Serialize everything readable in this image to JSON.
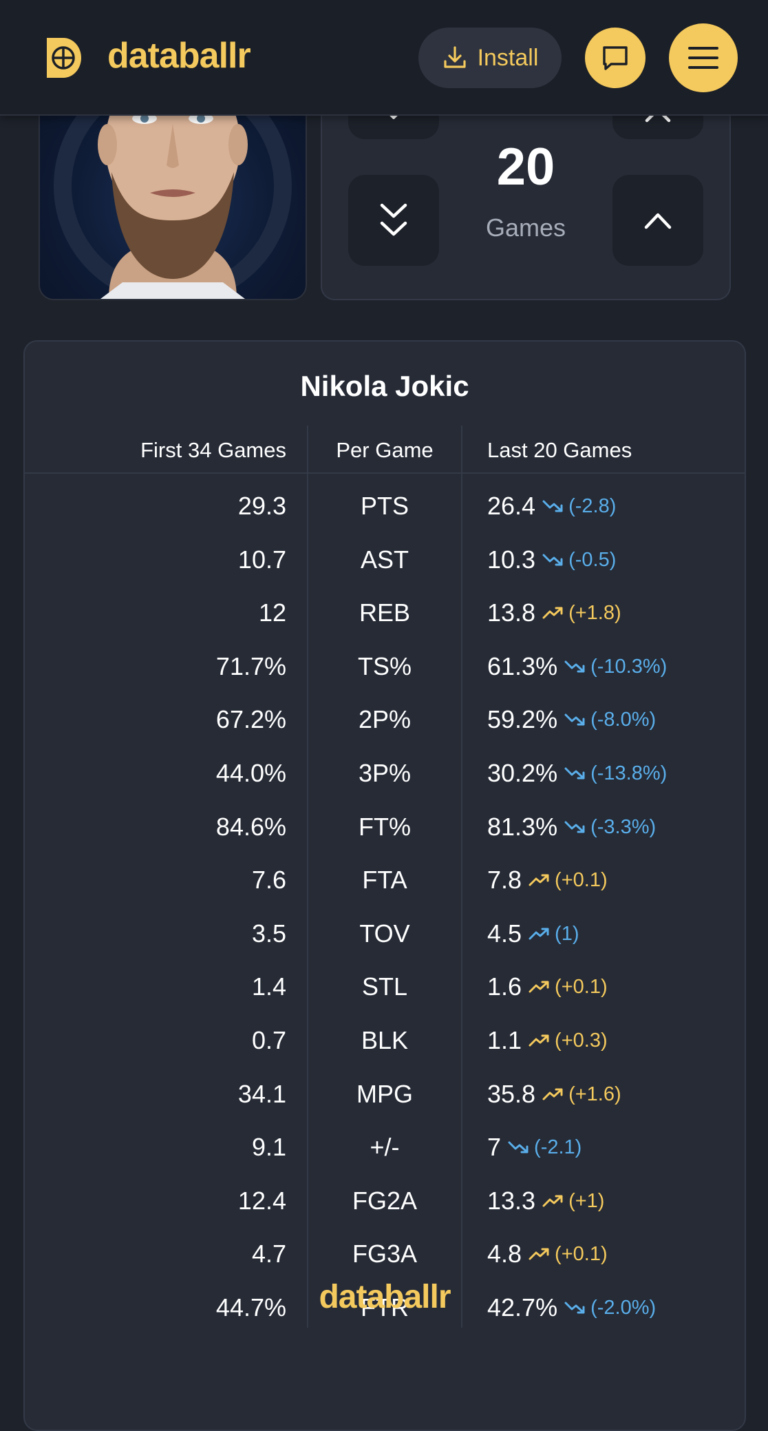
{
  "header": {
    "brand": "databallr",
    "install_label": "Install"
  },
  "games_selector": {
    "value": "20",
    "label": "Games"
  },
  "table": {
    "player_name": "Nikola Jokic",
    "headers": [
      "First 34 Games",
      "Per Game",
      "Last 20 Games"
    ],
    "rows": [
      {
        "first": "29.3",
        "label": "PTS",
        "last": "26.4",
        "dir": "down",
        "delta": "(-2.8)"
      },
      {
        "first": "10.7",
        "label": "AST",
        "last": "10.3",
        "dir": "down",
        "delta": "(-0.5)"
      },
      {
        "first": "12",
        "label": "REB",
        "last": "13.8",
        "dir": "up",
        "delta": "(+1.8)"
      },
      {
        "first": "71.7%",
        "label": "TS%",
        "last": "61.3%",
        "dir": "down",
        "delta": "(-10.3%)"
      },
      {
        "first": "67.2%",
        "label": "2P%",
        "last": "59.2%",
        "dir": "down",
        "delta": "(-8.0%)"
      },
      {
        "first": "44.0%",
        "label": "3P%",
        "last": "30.2%",
        "dir": "down",
        "delta": "(-13.8%)"
      },
      {
        "first": "84.6%",
        "label": "FT%",
        "last": "81.3%",
        "dir": "down",
        "delta": "(-3.3%)"
      },
      {
        "first": "7.6",
        "label": "FTA",
        "last": "7.8",
        "dir": "up",
        "delta": "(+0.1)"
      },
      {
        "first": "3.5",
        "label": "TOV",
        "last": "4.5",
        "dir": "up-blue",
        "delta": "(1)"
      },
      {
        "first": "1.4",
        "label": "STL",
        "last": "1.6",
        "dir": "up",
        "delta": "(+0.1)"
      },
      {
        "first": "0.7",
        "label": "BLK",
        "last": "1.1",
        "dir": "up",
        "delta": "(+0.3)"
      },
      {
        "first": "34.1",
        "label": "MPG",
        "last": "35.8",
        "dir": "up",
        "delta": "(+1.6)"
      },
      {
        "first": "9.1",
        "label": "+/-",
        "last": "7",
        "dir": "down",
        "delta": "(-2.1)"
      },
      {
        "first": "12.4",
        "label": "FG2A",
        "last": "13.3",
        "dir": "up",
        "delta": "(+1)"
      },
      {
        "first": "4.7",
        "label": "FG3A",
        "last": "4.8",
        "dir": "up",
        "delta": "(+0.1)"
      },
      {
        "first": "44.7%",
        "label": "FTR",
        "last": "42.7%",
        "dir": "down",
        "delta": "(-2.0%)"
      }
    ]
  },
  "footer": {
    "brand": "databallr"
  },
  "colors": {
    "accent": "#f4c95d",
    "trend_up": "#f4c95d",
    "trend_down": "#5aaeea",
    "background": "#1e222b",
    "card": "#262b36"
  },
  "icons": {
    "logo": "databallr-logo-icon",
    "install": "download-icon",
    "chat": "chat-bubble-icon",
    "menu": "hamburger-menu-icon",
    "decrease_one": "chevron-down-icon",
    "decrease_many": "double-chevron-down-icon",
    "increase": "chevron-up-icon",
    "trend_up": "trend-up-icon",
    "trend_down": "trend-down-icon"
  }
}
